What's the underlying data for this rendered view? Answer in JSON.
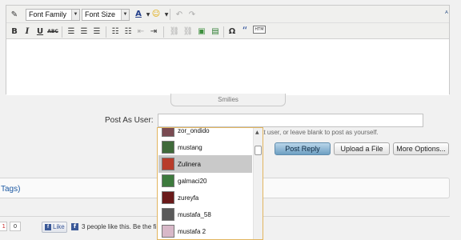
{
  "toolbar": {
    "font_family": "Font Family",
    "font_size": "Font Size",
    "text_color_glyph": "A",
    "quote_glyph": "“",
    "bold_glyph": "B",
    "italic_glyph": "I",
    "underline_glyph": "U",
    "strike_glyph": "ABC"
  },
  "smilies_label": "Smilies",
  "post_as_user": {
    "label": "Post As User:",
    "value": "",
    "hint": "at user, or leave blank to post as yourself."
  },
  "buttons": {
    "post_reply": "Post Reply",
    "upload_file": "Upload a File",
    "more_options": "More Options..."
  },
  "tags_link": "Tags)",
  "social": {
    "plus_count": "1",
    "count": "0",
    "like_label": "Like",
    "like_text": "3 people like this. Be the fi"
  },
  "dropdown": {
    "items": [
      {
        "name": "zor_ondido",
        "avatar": "#7a4b52"
      },
      {
        "name": "mustang",
        "avatar": "#3f6a3a"
      },
      {
        "name": "Zulinera",
        "avatar": "#b83c2a",
        "active": true
      },
      {
        "name": "galmaci20",
        "avatar": "#3d7a3d"
      },
      {
        "name": "zureyfa",
        "avatar": "#6a1a1a"
      },
      {
        "name": "mustafa_58",
        "avatar": "#5a5a5a"
      },
      {
        "name": "mustafa 2",
        "avatar": "#d8b8c8"
      }
    ]
  }
}
